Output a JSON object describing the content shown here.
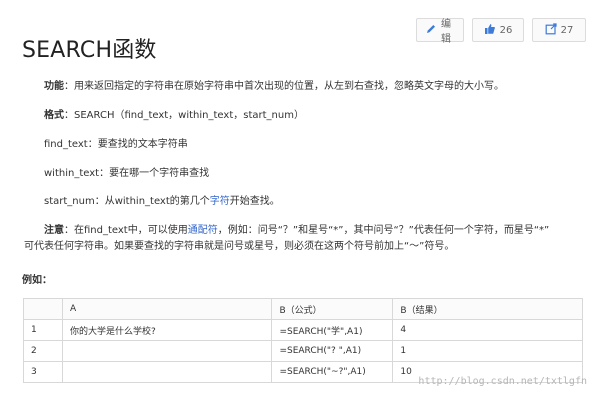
{
  "toolbar": {
    "edit_label": "编辑",
    "like_count": "26",
    "share_count": "27"
  },
  "title": "SEARCH函数",
  "paragraphs": {
    "function_label": "功能",
    "function_text": "：用来返回指定的字符串在原始字符串中首次出现的位置，从左到右查找，忽略英文字母的大小写。",
    "format_label": "格式",
    "format_text": "：SEARCH（find_text，within_text，start_num）",
    "find_text": "find_text：要查找的文本字符串",
    "within_text": "within_text：要在哪一个字符串查找",
    "start_num_prefix": "start_num：从within_text的第几个",
    "start_num_link": "字符",
    "start_num_suffix": "开始查找。",
    "note_label": "注意",
    "note_part1": "：在find_text中，可以使用",
    "note_link": "通配符",
    "note_part2": "，例如：问号“？”和星号“*”，其中问号“？”代表任何一个字符，而星号“*”",
    "note_line2": "可代表任何字符串。如果要查找的字符串就是问号或星号，则必须在这两个符号前加上“～”符号。"
  },
  "example_label": "例如：",
  "table": {
    "headers": [
      "",
      "A",
      "B（公式）",
      "B（结果）"
    ],
    "rows": [
      [
        "1",
        "你的大学是什么学校?",
        "=SEARCH(\"学\",A1)",
        "4"
      ],
      [
        "2",
        "",
        "=SEARCH(\"? \",A1)",
        "1"
      ],
      [
        "3",
        "",
        "=SEARCH(\"~?\",A1)",
        "10"
      ]
    ]
  },
  "watermark": "http://blog.csdn.net/txtlgfn",
  "icons": {
    "edit": "pencil-icon",
    "like": "thumbs-up-icon",
    "share": "share-icon"
  },
  "colors": {
    "link": "#3366cc",
    "accent": "#3d7bdb"
  }
}
